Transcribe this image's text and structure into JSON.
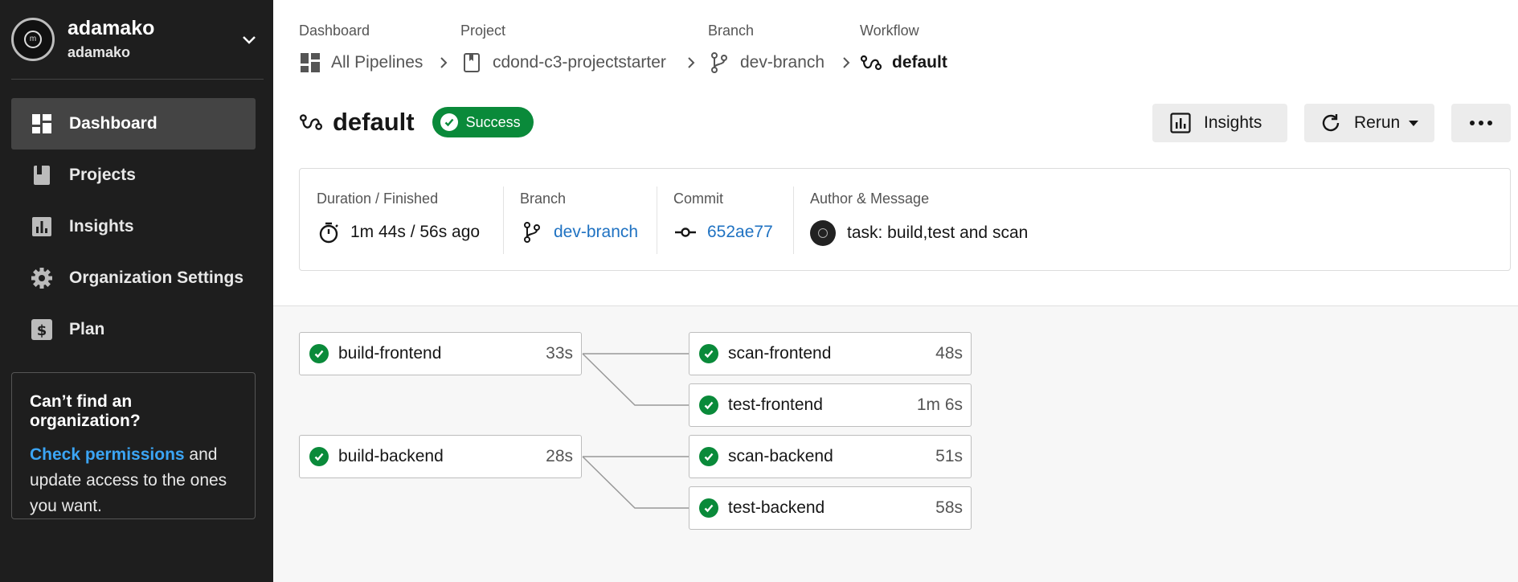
{
  "sidebar": {
    "org_name": "adamako",
    "org_sub": "adamako",
    "nav": [
      {
        "label": "Dashboard",
        "icon": "dashboard-icon",
        "active": true
      },
      {
        "label": "Projects",
        "icon": "projects-icon"
      },
      {
        "label": "Insights",
        "icon": "insights-icon"
      },
      {
        "label": "Organization Settings",
        "icon": "gear-icon"
      },
      {
        "label": "Plan",
        "icon": "dollar-icon"
      }
    ],
    "help": {
      "heading": "Can’t find an organization?",
      "link": "Check permissions",
      "text": " and update access to the ones you want."
    }
  },
  "breadcrumb": [
    {
      "label": "Dashboard",
      "value": "All Pipelines",
      "icon": "pipelines-icon"
    },
    {
      "label": "Project",
      "value": "cdond-c3-projectstarter",
      "icon": "project-icon"
    },
    {
      "label": "Branch",
      "value": "dev-branch",
      "icon": "branch-icon"
    },
    {
      "label": "Workflow",
      "value": "default",
      "icon": "workflow-icon"
    }
  ],
  "header": {
    "title": "default",
    "status": "Success",
    "insights_label": "Insights",
    "rerun_label": "Rerun",
    "more_label": "•••"
  },
  "info": {
    "duration_label": "Duration / Finished",
    "duration_value": "1m 44s / 56s ago",
    "branch_label": "Branch",
    "branch_value": "dev-branch",
    "commit_label": "Commit",
    "commit_value": "652ae77",
    "author_label": "Author & Message",
    "author_message": "task: build,test and scan"
  },
  "jobs": [
    {
      "name": "build-frontend",
      "duration": "33s"
    },
    {
      "name": "scan-frontend",
      "duration": "48s"
    },
    {
      "name": "test-frontend",
      "duration": "1m 6s"
    },
    {
      "name": "build-backend",
      "duration": "28s"
    },
    {
      "name": "scan-backend",
      "duration": "51s"
    },
    {
      "name": "test-backend",
      "duration": "58s"
    }
  ],
  "colors": {
    "success": "#0a8a3a",
    "link": "#1f72c2",
    "sidebar_bg": "#1e1e1e"
  }
}
